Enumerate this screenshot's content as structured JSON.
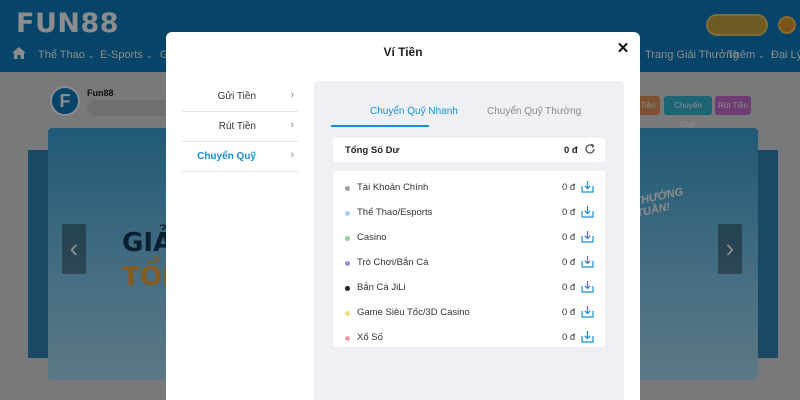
{
  "site": {
    "logo": "FUN88",
    "nav": [
      {
        "label": "Thể Thao",
        "chevron": true
      },
      {
        "label": "E-Sports",
        "chevron": true
      },
      {
        "label": "G",
        "chevron": false
      },
      {
        "label": "Trang Giải Thưởng",
        "chevron": false
      },
      {
        "label": "Thêm",
        "chevron": true
      },
      {
        "label": "Đại Lý",
        "chevron": false
      }
    ],
    "member_name": "Fun88",
    "chips": [
      {
        "label": "Tiền",
        "color": "#e3955c"
      },
      {
        "label": "Chuyển Quỹ",
        "color": "#35b6d6"
      },
      {
        "label": "Rút Tiền",
        "color": "#c86ccf"
      }
    ],
    "banner_line1": "GIẢ",
    "banner_line2": "TỔN",
    "banner_right": "O THƯỞNG\nN TUẦN!"
  },
  "modal": {
    "title": "Ví Tiền",
    "sidebar": [
      {
        "label": "Gửi Tiền",
        "active": false
      },
      {
        "label": "Rút Tiền",
        "active": false
      },
      {
        "label": "Chuyển Quỹ",
        "active": true
      }
    ],
    "tabs": [
      {
        "label": "Chuyển Quỹ Nhanh",
        "active": true
      },
      {
        "label": "Chuyển Quỹ Thường",
        "active": false
      }
    ],
    "total": {
      "label": "Tổng Số Dư",
      "value": "0 đ"
    },
    "accounts": [
      {
        "name": "Tài Khoản Chính",
        "amount": "0 đ",
        "color": "#9e9e9e"
      },
      {
        "name": "Thể Thao/Esports",
        "amount": "0 đ",
        "color": "#a9d4ee"
      },
      {
        "name": "Casino",
        "amount": "0 đ",
        "color": "#8fd28f"
      },
      {
        "name": "Trò Chơi/Bắn Cá",
        "amount": "0 đ",
        "color": "#9a8fe0"
      },
      {
        "name": "Bắn Cá JiLi",
        "amount": "0 đ",
        "color": "#222222"
      },
      {
        "name": "Game Siêu Tốc/3D Casino",
        "amount": "0 đ",
        "color": "#f2dc7a"
      },
      {
        "name": "Xổ Số",
        "amount": "0 đ",
        "color": "#f29aa8"
      }
    ],
    "accent": "#1a8fd6"
  }
}
